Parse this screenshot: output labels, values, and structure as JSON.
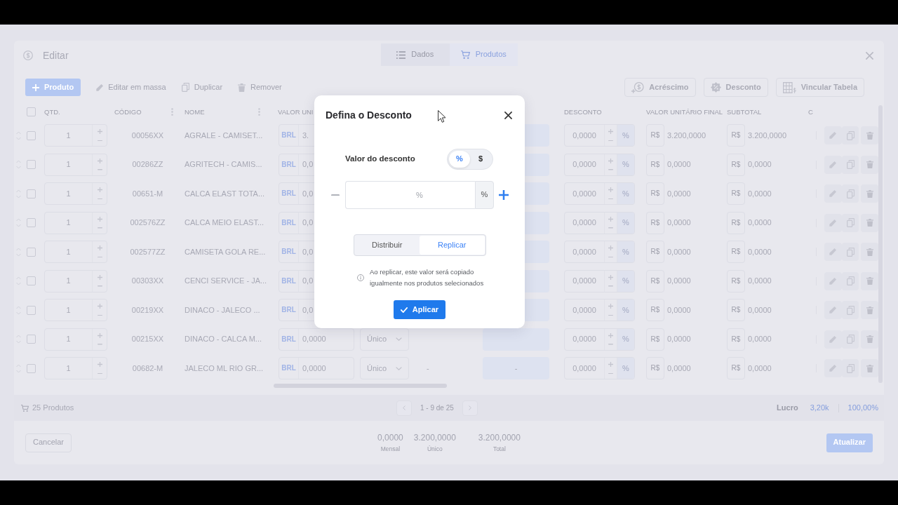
{
  "window": {
    "title": "Editar",
    "tabs": [
      {
        "label": "Dados",
        "selected": false
      },
      {
        "label": "Produtos",
        "selected": true
      }
    ]
  },
  "toolbar": {
    "left": [
      {
        "label": "Produto",
        "kind": "primary",
        "disabled": false
      },
      {
        "label": "Editar em massa",
        "kind": "plain",
        "disabled": true
      },
      {
        "label": "Duplicar",
        "kind": "plain",
        "disabled": true
      },
      {
        "label": "Remover",
        "kind": "plain",
        "disabled": true
      }
    ],
    "right": [
      {
        "label": "Acréscimo"
      },
      {
        "label": "Desconto"
      },
      {
        "label": "Vincular Tabela"
      }
    ]
  },
  "table": {
    "all_checked": false,
    "columns": [
      {
        "label": "QTD."
      },
      {
        "label": "CÓDIGO"
      },
      {
        "label": "NOME"
      },
      {
        "label": "VALOR UNI"
      },
      {
        "label": "DESCONTO"
      },
      {
        "label": "VALOR UNITÁRIO FINAL"
      },
      {
        "label": "SUBTOTAL"
      },
      {
        "label": "C"
      }
    ],
    "rows": [
      {
        "checked": false,
        "qty": "1",
        "code": "00056XX",
        "name": "AGRALE - CAMISET...",
        "currency": "BRL",
        "unit_value": "3.",
        "discount": "0,0000",
        "discount_unit": "%",
        "final_currency": "R$",
        "final_value": "3.200,0000",
        "subtotal_currency": "R$",
        "subtotal": "3.200,0000"
      },
      {
        "checked": false,
        "qty": "1",
        "code": "00286ZZ",
        "name": "AGRITECH - CAMIS...",
        "currency": "BRL",
        "unit_value": "0,0",
        "discount": "0,0000",
        "discount_unit": "%",
        "final_currency": "R$",
        "final_value": "0,0000",
        "subtotal_currency": "R$",
        "subtotal": "0,0000"
      },
      {
        "checked": false,
        "qty": "1",
        "code": "00651-M",
        "name": "CALCA ELAST TOTA...",
        "currency": "BRL",
        "unit_value": "0,0",
        "discount": "0,0000",
        "discount_unit": "%",
        "final_currency": "R$",
        "final_value": "0,0000",
        "subtotal_currency": "R$",
        "subtotal": "0,0000"
      },
      {
        "checked": false,
        "qty": "1",
        "code": "002576ZZ",
        "name": "CALCA MEIO ELAST...",
        "currency": "BRL",
        "unit_value": "0,0",
        "discount": "0,0000",
        "discount_unit": "%",
        "final_currency": "R$",
        "final_value": "0,0000",
        "subtotal_currency": "R$",
        "subtotal": "0,0000"
      },
      {
        "checked": false,
        "qty": "1",
        "code": "002577ZZ",
        "name": "CAMISETA GOLA RE...",
        "currency": "BRL",
        "unit_value": "0,0",
        "discount": "0,0000",
        "discount_unit": "%",
        "final_currency": "R$",
        "final_value": "0,0000",
        "subtotal_currency": "R$",
        "subtotal": "0,0000"
      },
      {
        "checked": false,
        "qty": "1",
        "code": "00303XX",
        "name": "CENCI SERVICE - JA...",
        "currency": "BRL",
        "unit_value": "0,0",
        "discount": "0,0000",
        "discount_unit": "%",
        "final_currency": "R$",
        "final_value": "0,0000",
        "subtotal_currency": "R$",
        "subtotal": "0,0000"
      },
      {
        "checked": false,
        "qty": "1",
        "code": "00219XX",
        "name": "DINACO - JALECO ...",
        "currency": "BRL",
        "unit_value": "0,0",
        "discount": "0,0000",
        "discount_unit": "%",
        "final_currency": "R$",
        "final_value": "0,0000",
        "subtotal_currency": "R$",
        "subtotal": "0,0000"
      },
      {
        "checked": false,
        "qty": "1",
        "code": "00215XX",
        "name": "DINACO - CALCA M...",
        "currency": "BRL",
        "unit_value": "0,0000",
        "unit": "Único",
        "discount": "0,0000",
        "discount_unit": "%",
        "final_currency": "R$",
        "final_value": "0,0000",
        "subtotal_currency": "R$",
        "subtotal": "0,0000"
      },
      {
        "checked": false,
        "qty": "1",
        "code": "00682-M",
        "name": "JALECO ML RIO GR...",
        "currency": "BRL",
        "unit_value": "0,0000",
        "unit": "Único",
        "column_6": "-",
        "column_7": "-",
        "discount": "0,0000",
        "discount_unit": "%",
        "final_currency": "R$",
        "final_value": "0,0000",
        "subtotal_currency": "R$",
        "subtotal": "0,0000"
      }
    ]
  },
  "footer": {
    "count": "25 Produtos",
    "page_info": "1 - 9 de 25",
    "profit": {
      "label": "Lucro",
      "value": "3,20k",
      "percent": "100,00%"
    }
  },
  "actions": {
    "cancel": "Cancelar",
    "summary": [
      {
        "value": "0,0000",
        "label": "Mensal"
      },
      {
        "value": "3.200,0000",
        "label": "Único"
      },
      {
        "value": "3.200,0000",
        "label": "Total"
      }
    ],
    "submit": "Atualizar"
  },
  "modal": {
    "title": "Defina o Desconto",
    "field_label": "Valor do desconto",
    "mode_toggle": [
      {
        "label": "%",
        "selected": true
      },
      {
        "label": "$",
        "selected": false
      }
    ],
    "input": {
      "placeholder": "%",
      "addon": "%"
    },
    "distribution": [
      {
        "label": "Distribuir",
        "selected": false
      },
      {
        "label": "Replicar",
        "selected": true
      }
    ],
    "hint": "Ao replicar, este valor será copiado igualmente nos produtos selecionados",
    "apply": "Aplicar"
  }
}
